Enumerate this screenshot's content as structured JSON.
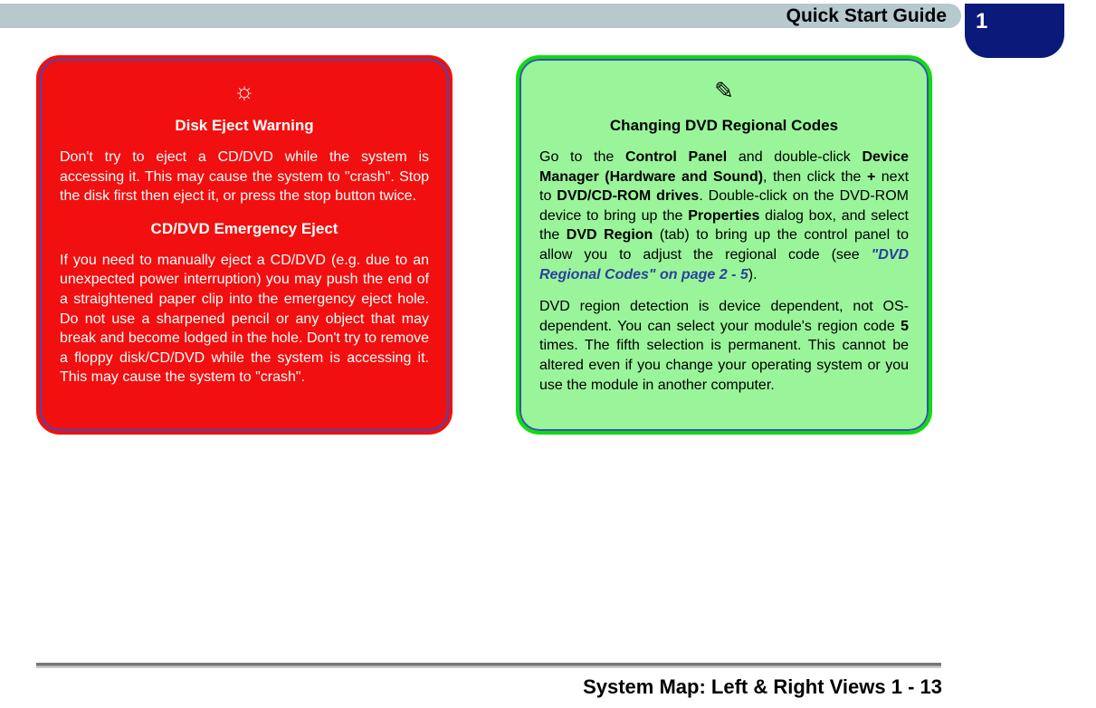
{
  "header": {
    "title": "Quick Start Guide"
  },
  "chapter": "1",
  "red_box": {
    "icon": "☼",
    "title1": "Disk Eject Warning",
    "para1": "Don't try to eject a CD/DVD while the system is accessing it. This may cause the system to \"crash\". Stop the disk first then eject it, or press the stop button twice.",
    "title2": "CD/DVD Emergency Eject",
    "para2": "If you need to manually eject a CD/DVD (e.g. due to an unexpected power interruption) you may push the end of a straightened paper clip into the emergency eject hole. Do not use a sharpened pencil or any object that may break and become lodged in the hole. Don't try to remove a floppy disk/CD/DVD while the system is accessing it. This may cause the system to \"crash\"."
  },
  "green_box": {
    "icon": "✎",
    "title": "Changing DVD Regional Codes",
    "p1_a": "Go to the ",
    "p1_b": "Control Panel",
    "p1_c": " and double-click ",
    "p1_d": "Device Manager (Hardware and Sound)",
    "p1_e": ", then click the ",
    "p1_f": "+",
    "p1_g": " next to ",
    "p1_h": "DVD/CD-ROM drives",
    "p1_i": ". Double-click on the DVD-ROM device to bring up the ",
    "p1_j": "Properties",
    "p1_k": " dialog box, and select the ",
    "p1_l": "DVD Region",
    "p1_m": " (tab) to bring up the control panel to allow you to adjust the regional code (see ",
    "p1_link": "\"DVD Regional Codes\" on page 2 - 5",
    "p1_n": ").",
    "p2_a": "DVD region detection is device dependent, not OS-dependent. You can select your module's region code ",
    "p2_b": "5",
    "p2_c": " times. The fifth selection is permanent. This cannot be altered even if you change your operating system or you use the module in another computer."
  },
  "footer": "System Map: Left & Right Views 1 - 13"
}
